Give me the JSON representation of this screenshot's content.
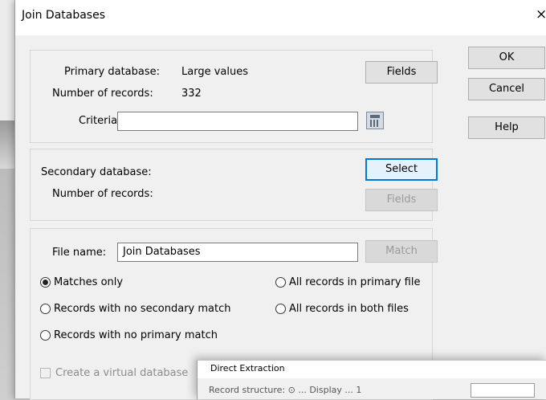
{
  "window": {
    "title": "Join Databases",
    "close_glyph": "×"
  },
  "primary": {
    "db_label": "Primary database:",
    "db_value": "Large values",
    "records_label": "Number of records:",
    "records_value": "332",
    "criteria_label": "Criteria:",
    "criteria_value": "",
    "fields_button": "Fields"
  },
  "secondary": {
    "db_label": "Secondary database:",
    "records_label": "Number of records:",
    "select_button": "Select",
    "fields_button": "Fields"
  },
  "output": {
    "file_name_label": "File name:",
    "file_name_value": "Join Databases",
    "match_button": "Match",
    "options": [
      {
        "label": "Matches only",
        "selected": true
      },
      {
        "label": "All records in primary file",
        "selected": false
      },
      {
        "label": "Records with no secondary match",
        "selected": false
      },
      {
        "label": "All records in both files",
        "selected": false
      },
      {
        "label": "Records with no primary match",
        "selected": false
      }
    ],
    "virtual_db_label": "Create a virtual database",
    "virtual_db_checked": false
  },
  "side_buttons": {
    "ok": "OK",
    "cancel": "Cancel",
    "help": "Help"
  },
  "sub_window": {
    "title": "Direct Extraction",
    "partial_row": "Record structure: ⊙ ... Display ... 1"
  },
  "colors": {
    "focus": "#0078d7",
    "dialog_bg": "#f0f0f0"
  }
}
